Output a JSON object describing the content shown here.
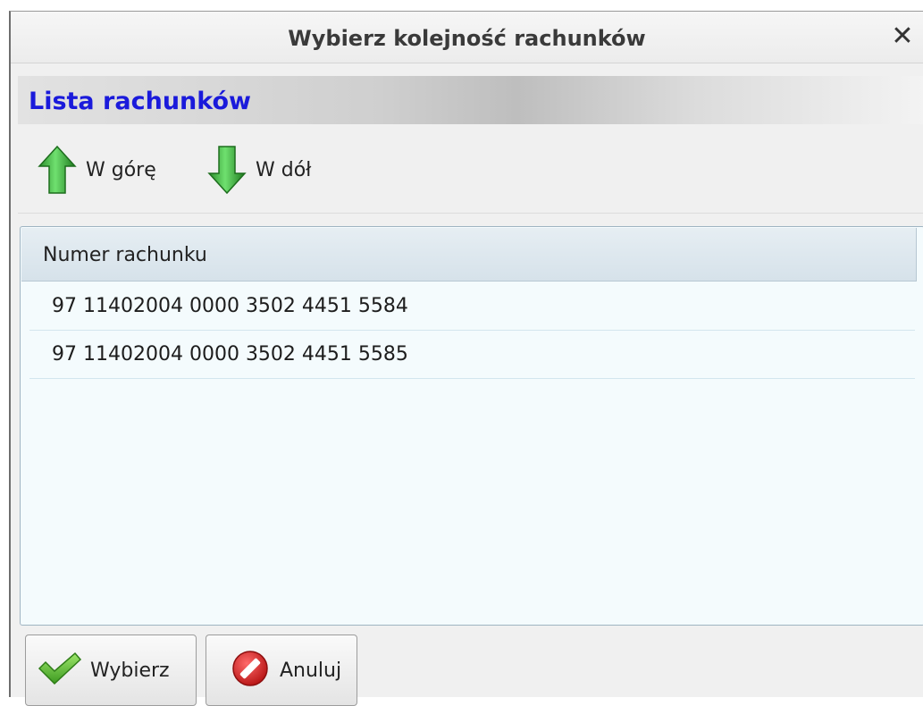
{
  "window": {
    "title": "Wybierz kolejność rachunków",
    "close_glyph": "✕"
  },
  "section": {
    "title": "Lista rachunków"
  },
  "toolbar": {
    "up": {
      "label": "W górę",
      "icon": "arrow-up-icon",
      "color": "#35b435"
    },
    "down": {
      "label": "W dół",
      "icon": "arrow-down-icon",
      "color": "#35b435"
    }
  },
  "grid": {
    "columns": [
      "Numer rachunku"
    ],
    "rows": [
      "97 11402004 0000 3502 4451 5584",
      "97 11402004 0000 3502 4451 5585"
    ]
  },
  "buttons": {
    "select": {
      "label": "Wybierz",
      "icon": "checkmark-icon",
      "color": "#4caf2a"
    },
    "cancel": {
      "label": "Anuluj",
      "icon": "cancel-icon",
      "color": "#d62020"
    }
  },
  "colors": {
    "section_title": "#1a1adb",
    "grid_background": "#f4fbfd",
    "grid_header": "#d6e2ea"
  }
}
